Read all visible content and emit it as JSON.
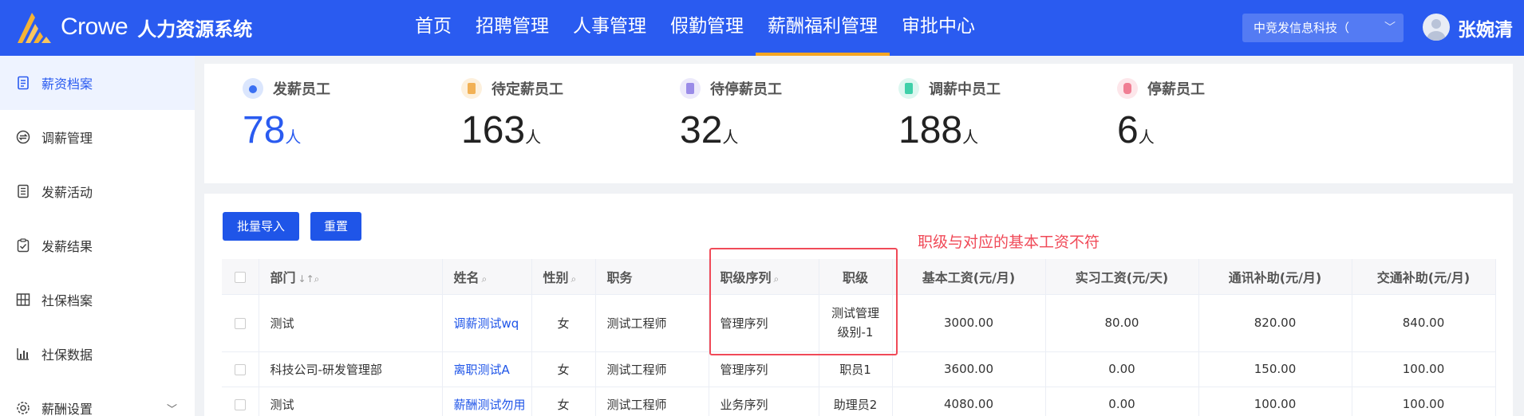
{
  "header": {
    "logo_text": "Crowe",
    "system_name": "人力资源系统",
    "nav": [
      "首页",
      "招聘管理",
      "人事管理",
      "假勤管理",
      "薪酬福利管理",
      "审批中心"
    ],
    "active_nav": "薪酬福利管理",
    "company": "中竞发信息科技（",
    "user": "张婉清",
    "accent": "#2a5bf0",
    "active_underline": "#f5a623"
  },
  "sidebar": {
    "items": [
      {
        "label": "薪资档案",
        "icon": "document-icon",
        "active": true
      },
      {
        "label": "调薪管理",
        "icon": "exchange-icon"
      },
      {
        "label": "发薪活动",
        "icon": "list-icon"
      },
      {
        "label": "发薪结果",
        "icon": "check-clipboard-icon"
      },
      {
        "label": "社保档案",
        "icon": "grid-icon"
      },
      {
        "label": "社保数据",
        "icon": "bar-chart-icon"
      },
      {
        "label": "薪酬设置",
        "icon": "gear-icon"
      }
    ]
  },
  "stats": [
    {
      "label": "发薪员工",
      "value": "78",
      "unit": "人",
      "color": "#2a5bf0",
      "icon_color": "#dbe6fd",
      "icon_fg": "#3a6ff2"
    },
    {
      "label": "待定薪员工",
      "value": "163",
      "unit": "人",
      "color": "#222222",
      "icon_color": "#fdf0dc",
      "icon_fg": "#f2b155"
    },
    {
      "label": "待停薪员工",
      "value": "32",
      "unit": "人",
      "color": "#222222",
      "icon_color": "#ece9fb",
      "icon_fg": "#9a8be8"
    },
    {
      "label": "调薪中员工",
      "value": "188",
      "unit": "人",
      "color": "#222222",
      "icon_color": "#dcf7f0",
      "icon_fg": "#3fd0a9"
    },
    {
      "label": "停薪员工",
      "value": "6",
      "unit": "人",
      "color": "#222222",
      "icon_color": "#fde6ea",
      "icon_fg": "#f07e93"
    }
  ],
  "toolbar": {
    "import_label": "批量导入",
    "reset_label": "重置"
  },
  "annotation": "职级与对应的基本工资不符",
  "table": {
    "headers": [
      "部门",
      "姓名",
      "性别",
      "职务",
      "职级序列",
      "职级",
      "基本工资(元/月)",
      "实习工资(元/天)",
      "通讯补助(元/月)",
      "交通补助(元/月)"
    ],
    "rows": [
      [
        "测试",
        "调薪测试wq",
        "女",
        "测试工程师",
        "管理序列",
        "测试管理级别-1",
        "3000.00",
        "80.00",
        "820.00",
        "840.00"
      ],
      [
        "科技公司-研发管理部",
        "离职测试A",
        "女",
        "测试工程师",
        "管理序列",
        "职员1",
        "3600.00",
        "0.00",
        "150.00",
        "100.00"
      ],
      [
        "测试",
        "薪酬测试勿用",
        "女",
        "测试工程师",
        "业务序列",
        "助理员2",
        "4080.00",
        "0.00",
        "100.00",
        "100.00"
      ]
    ]
  }
}
